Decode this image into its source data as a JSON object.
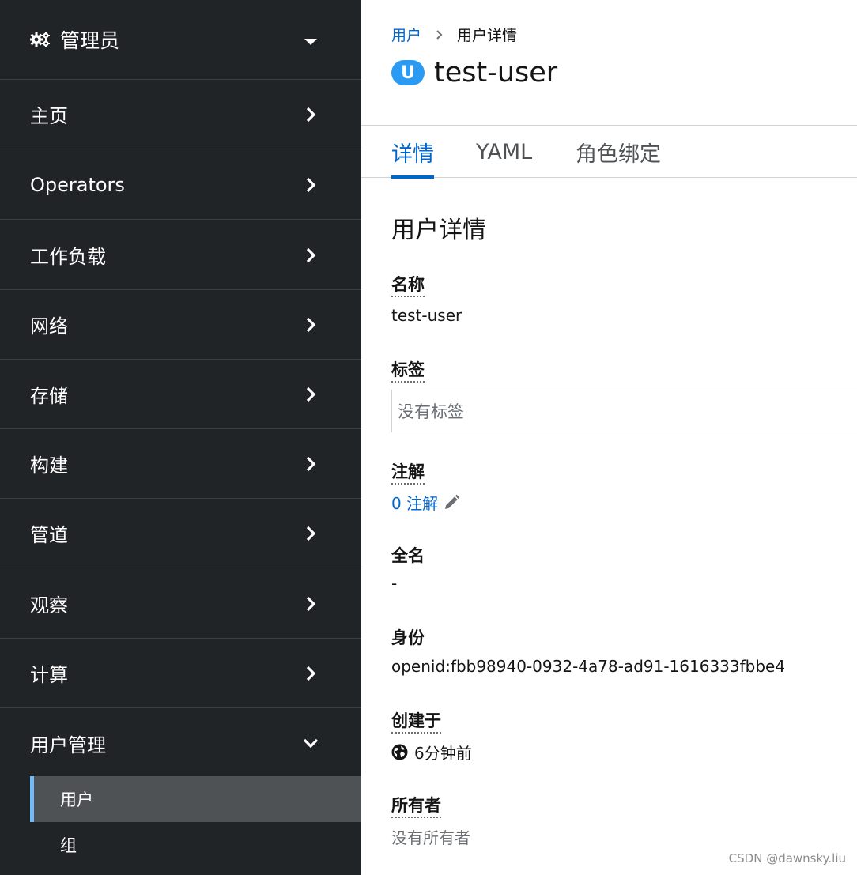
{
  "sidebar": {
    "perspective": {
      "label": "管理员",
      "icon": "gears-icon"
    },
    "items": [
      {
        "label": "主页"
      },
      {
        "label": "Operators"
      },
      {
        "label": "工作负载"
      },
      {
        "label": "网络"
      },
      {
        "label": "存储"
      },
      {
        "label": "构建"
      },
      {
        "label": "管道"
      },
      {
        "label": "观察"
      },
      {
        "label": "计算"
      },
      {
        "label": "用户管理"
      }
    ],
    "sub_items": [
      {
        "label": "用户",
        "active": true
      },
      {
        "label": "组",
        "active": false
      }
    ],
    "colors": {
      "background": "#212427",
      "active_item": "#4f5255",
      "active_indicator": "#73bcf7"
    }
  },
  "breadcrumb": {
    "parent": "用户",
    "current": "用户详情"
  },
  "header": {
    "badge": "U",
    "title": "test-user",
    "badge_color": "#2b9af3"
  },
  "tabs": [
    {
      "label": "详情",
      "active": true
    },
    {
      "label": "YAML",
      "active": false
    },
    {
      "label": "角色绑定",
      "active": false
    }
  ],
  "details": {
    "section_title": "用户详情",
    "name_label": "名称",
    "name_value": "test-user",
    "labels_label": "标签",
    "labels_value": "没有标签",
    "annotations_label": "注解",
    "annotations_value": "0 注解",
    "full_name_label": "全名",
    "full_name_value": "-",
    "identity_label": "身份",
    "identity_value": "openid:fbb98940-0932-4a78-ad91-1616333fbbe4",
    "created_label": "创建于",
    "created_value": "6分钟前",
    "owner_label": "所有者",
    "owner_value": "没有所有者"
  },
  "accent_color": "#0066cc",
  "watermark": "CSDN @dawnsky.liu"
}
